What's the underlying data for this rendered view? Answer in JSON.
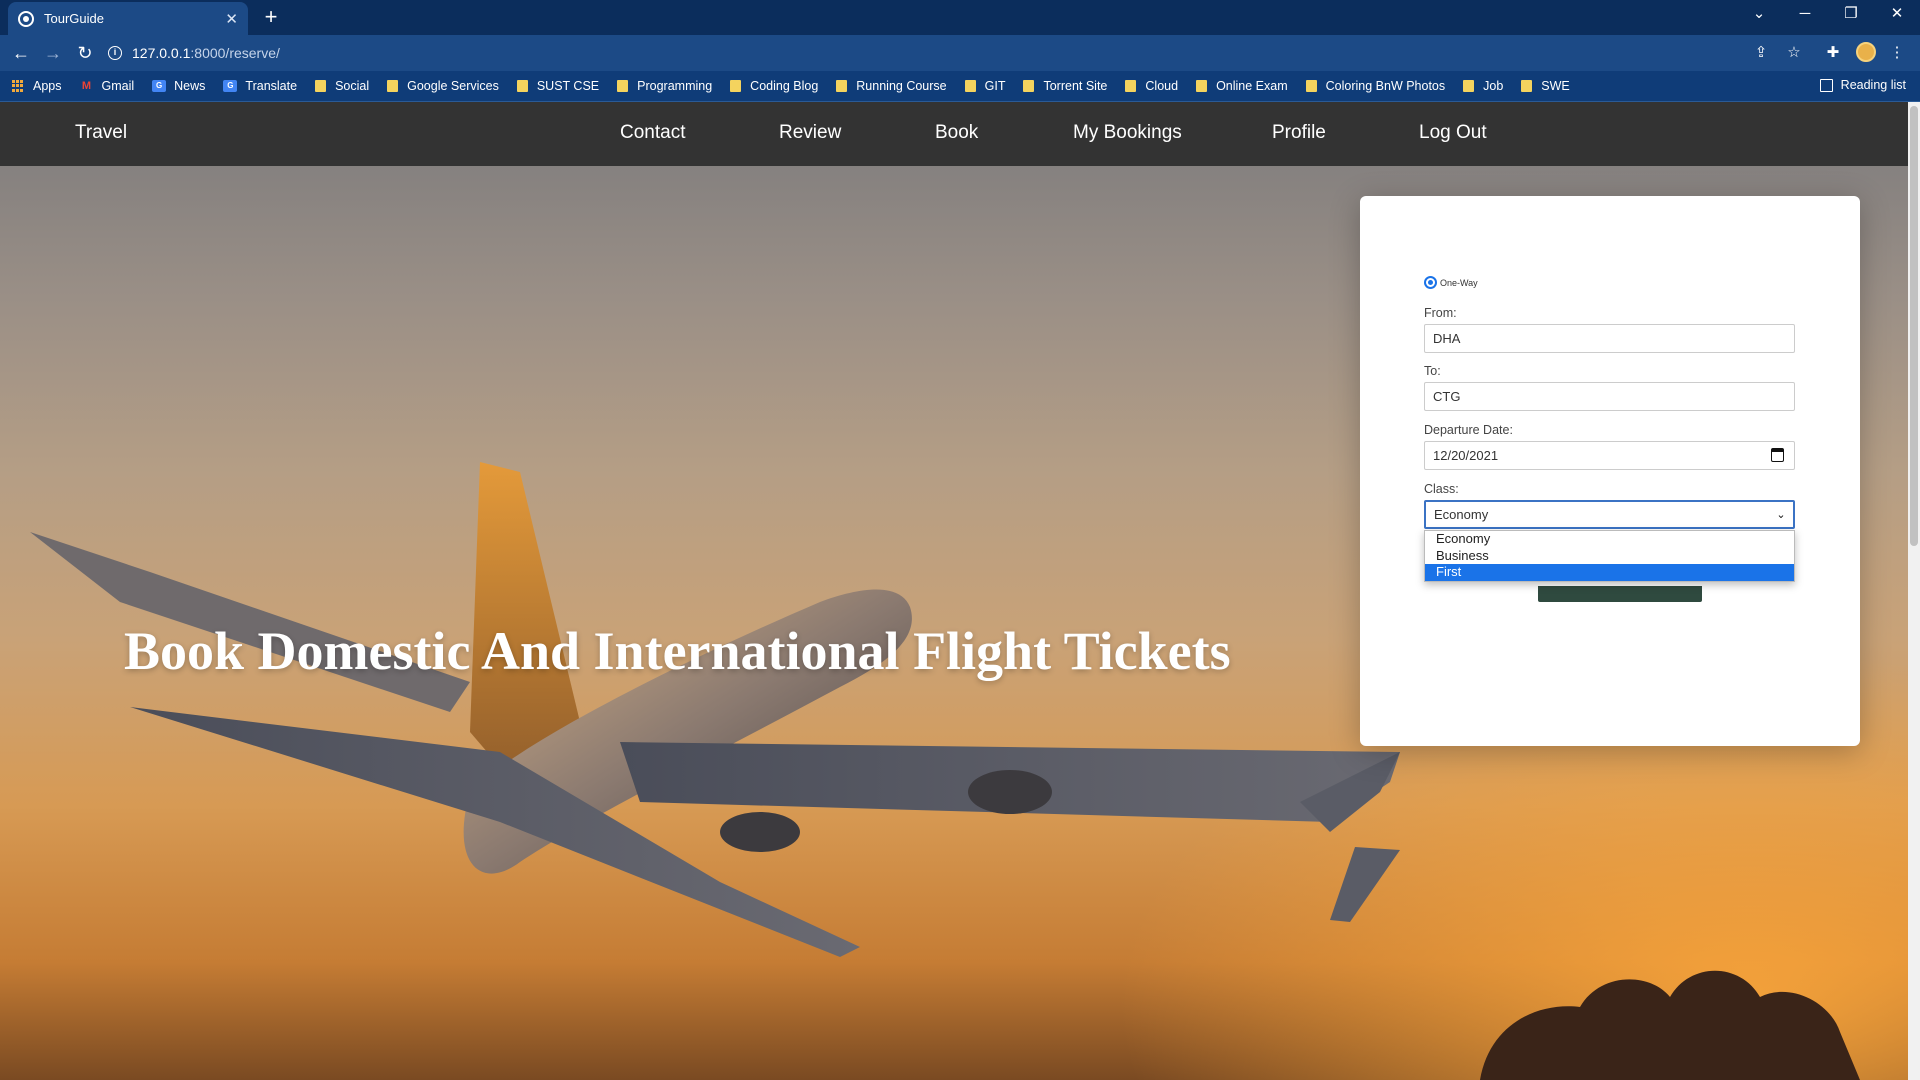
{
  "browser": {
    "tab_title": "TourGuide",
    "url_host": "127.0.0.1",
    "url_path": ":8000/reserve/",
    "bookmarks": [
      {
        "label": "Apps",
        "icon": "apps-grid-icon"
      },
      {
        "label": "Gmail",
        "icon": "gmail-icon"
      },
      {
        "label": "News",
        "icon": "news-icon"
      },
      {
        "label": "Translate",
        "icon": "translate-icon"
      },
      {
        "label": "Social",
        "icon": "folder-icon"
      },
      {
        "label": "Google Services",
        "icon": "folder-icon"
      },
      {
        "label": "SUST CSE",
        "icon": "folder-icon"
      },
      {
        "label": "Programming",
        "icon": "folder-icon"
      },
      {
        "label": "Coding Blog",
        "icon": "folder-icon"
      },
      {
        "label": "Running Course",
        "icon": "folder-icon"
      },
      {
        "label": "GIT",
        "icon": "folder-icon"
      },
      {
        "label": "Torrent Site",
        "icon": "folder-icon"
      },
      {
        "label": "Cloud",
        "icon": "folder-icon"
      },
      {
        "label": "Online Exam",
        "icon": "folder-icon"
      },
      {
        "label": "Coloring BnW Photos",
        "icon": "folder-icon"
      },
      {
        "label": "Job",
        "icon": "folder-icon"
      },
      {
        "label": "SWE",
        "icon": "folder-icon"
      }
    ],
    "reading_list": "Reading list",
    "theme": {
      "tabbar": "#0b2d5c",
      "toolbar": "#1c4a86",
      "bookmarks_bar": "#0f3c78"
    }
  },
  "site": {
    "brand": "Travel",
    "nav": [
      "Contact",
      "Review",
      "Book",
      "My Bookings",
      "Profile",
      "Log Out"
    ],
    "headline": "Book Domestic And International Flight Tickets",
    "nav_bg": "#333333"
  },
  "form": {
    "trip_type": "One-Way",
    "from_label": "From:",
    "from_value": "DHA",
    "to_label": "To:",
    "to_value": "CTG",
    "date_label": "Departure Date:",
    "date_value": "12/20/2021",
    "class_label": "Class:",
    "class_value": "Economy",
    "class_options": [
      "Economy",
      "Business",
      "First"
    ],
    "highlighted_option": "First",
    "accent": "#1a73e8"
  }
}
